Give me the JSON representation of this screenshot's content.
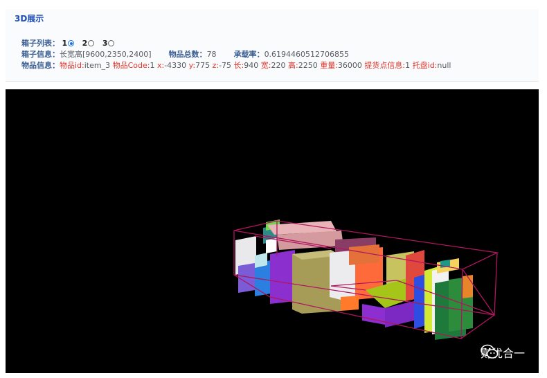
{
  "panel": {
    "title": "3D展示",
    "box_list": {
      "label": "箱子列表：",
      "options": [
        "1",
        "2",
        "3"
      ],
      "selected": "1"
    },
    "box_info": {
      "label": "箱子信息：",
      "value": "长宽高[9600,2350,2400]",
      "total_label": "物品总数：",
      "total_value": "78",
      "rate_label": "承载率：",
      "rate_value": "0.6194460512706855"
    },
    "item_info": {
      "label": "物品信息：",
      "id_label": "物品id:",
      "id_value": "item_3",
      "code_label": "物品Code:",
      "code_value": "1",
      "x_label": "x:",
      "x_value": "-4330",
      "y_label": "y:",
      "y_value": "775",
      "z_label": "z:",
      "z_value": "-75",
      "l_label": "长:",
      "l_value": "940",
      "w_label": "宽:",
      "w_value": "220",
      "h_label": "高:",
      "h_value": "2250",
      "weight_label": "重量:",
      "weight_value": "36000",
      "point_label": "提货点信息:",
      "point_value": "1",
      "pallet_label": "托盘id:",
      "pallet_value": "null"
    }
  },
  "viewport": {
    "background": "#000000",
    "container_color": "#b0155f",
    "icon": "container-3d-view"
  },
  "watermark": {
    "text": "则优合一",
    "icon": "wechat-icon"
  }
}
